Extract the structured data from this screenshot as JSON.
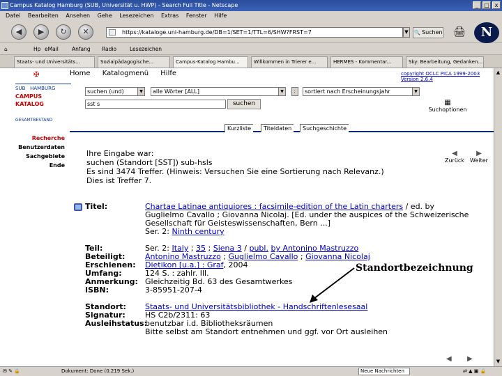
{
  "window": {
    "title": "Campus Katalog Hamburg (SUB, Universität u. HWP) - Search Full Title - Netscape",
    "buttons": [
      "_",
      "□",
      "x"
    ]
  },
  "menu": [
    "Datei",
    "Bearbeiten",
    "Ansehen",
    "Gehe",
    "Lesezeichen",
    "Extras",
    "Fenster",
    "Hilfe"
  ],
  "nav": {
    "url": "https://kataloge.uni-hamburg.de/DB=1/SET=1/TTL=6/SHW?FRST=7",
    "search_label": "Suchen"
  },
  "bookmarks": [
    "Hp",
    "eMail",
    "Anfang",
    "Radio",
    "Lesezeichen"
  ],
  "tabs": [
    "Staats- und Universitäts...",
    "Sozialpädagogische...",
    "Campus-Katalog Hambu...",
    "Willkommen in Trierer e...",
    "HERMES - Kommentar...",
    "Sky: Bearbeitung, Gedanken..."
  ],
  "page": {
    "topnav": [
      "Home",
      "Katalogmenü",
      "Hilfe"
    ],
    "copyright": "copyright OCLC PICA 1999-2003 Version 2.6.4",
    "logo": {
      "line1": "SUB",
      "line1b": "HAMBURG",
      "line2": "CAMPUS",
      "line3": "KATALOG",
      "line4": "GESAMTBESTAND"
    },
    "search": {
      "mode": "suchen (und)",
      "index": "alle Wörter [ALL]",
      "query": "sst s",
      "sort": "sortiert nach Erscheinungsjahr",
      "button": "suchen",
      "options": "Suchoptionen"
    },
    "view_tabs": [
      "Kurzliste",
      "Titeldaten",
      "Suchgeschichte"
    ],
    "leftnav": {
      "header": "Recherche",
      "items": [
        "Benutzerdaten",
        "Sachgebiete",
        "Ende"
      ]
    },
    "info": {
      "l1": "Ihre Eingabe war:",
      "l2": "suchen (Standort [SST]) sub-hsls",
      "l3": "Es sind 3474 Treffer.  (Hinweis: Versuchen Sie eine Sortierung nach Relevanz.)",
      "l4": "Dies ist Treffer 7."
    },
    "prev": "Zurück",
    "next": "Weiter",
    "record": {
      "titel_label": "Titel:",
      "titel_link": "Chartae Latinae antiquiores : facsimile-edition of the Latin charters",
      "titel_rest1": " / ed. by",
      "titel_rest2": "Guglielmo Cavallo ; Giovanna Nicolaj. [Ed. under the auspices of the Schweizerische",
      "titel_rest3": "Gesellschaft für Geisteswissenschaften, Bern ...]",
      "titel_rest4": "Ser. 2: ",
      "titel_rest4_link": "Ninth century",
      "teil_label": "Teil:",
      "teil_pre": "Ser. 2: ",
      "teil_l1": "Italy",
      "teil_l2": "35",
      "teil_l3": "Siena 3",
      "teil_l4": "publ.",
      "teil_l5": "by Antonino Mastruzzo",
      "beteiligt_label": "Beteiligt:",
      "beteiligt_1": "Antonino Mastruzzo",
      "beteiligt_2": "Guglielmo Cavallo",
      "beteiligt_3": "Giovanna Nicolaj",
      "erschienen_label": "Erschienen:",
      "erschienen_link": "Dietikon [u.a.] : Graf",
      "erschienen_rest": ", 2004",
      "umfang_label": "Umfang:",
      "umfang": "124 S. : zahlr. Ill.",
      "anmerkung_label": "Anmerkung:",
      "anmerkung": "Gleichzeitig Bd. 63 des Gesamtwerkes",
      "isbn_label": "ISBN:",
      "isbn": "3-85951-207-4",
      "standort_label": "Standort:",
      "standort": "Staats- und Universitätsbibliothek - Handschriftenlesesaal",
      "signatur_label": "Signatur:",
      "signatur": "HS C2b/2311: 63",
      "ausleih_label": "Ausleihstatus:",
      "ausleih1": "benutzbar i.d. Bibliotheksräumen",
      "ausleih2": "Bitte selbst am Standort entnehmen und ggf. vor Ort ausleihen"
    },
    "annotation": "Standortbezeichnung"
  },
  "status": {
    "text": "Dokument: Done (0.219 Sek.)",
    "news": "Neue Nachrichten"
  }
}
